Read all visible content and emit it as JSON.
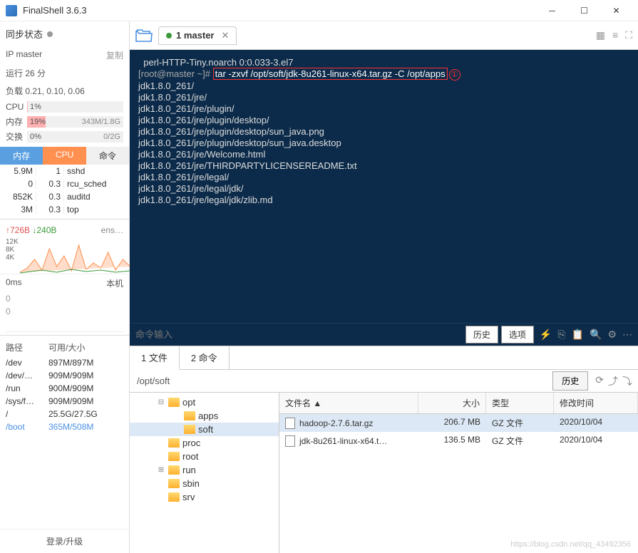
{
  "title": "FinalShell 3.6.3",
  "sidebar": {
    "sync_label": "同步状态",
    "ip_label": "IP master",
    "copy_label": "复制",
    "runtime": "运行 26 分",
    "load": "负载 0.21, 0.10, 0.06",
    "cpu_label": "CPU",
    "cpu_pct": "1%",
    "mem_label": "内存",
    "mem_pct": "19%",
    "mem_val": "343M/1.8G",
    "swap_label": "交换",
    "swap_pct": "0%",
    "swap_val": "0/2G",
    "tabs": {
      "mem": "内存",
      "cpu": "CPU",
      "cmd": "命令"
    },
    "procs": [
      {
        "mem": "5.9M",
        "cpu": "1",
        "name": "sshd"
      },
      {
        "mem": "0",
        "cpu": "0.3",
        "name": "rcu_sched"
      },
      {
        "mem": "852K",
        "cpu": "0.3",
        "name": "auditd"
      },
      {
        "mem": "3M",
        "cpu": "0.3",
        "name": "top"
      }
    ],
    "net_up": "726B",
    "net_down": "240B",
    "net_if": "ens…",
    "y12k": "12K",
    "y8k": "8K",
    "y4k": "4K",
    "ms": "0ms",
    "host_label": "本机",
    "z1": "0",
    "z2": "0",
    "disk_hdr": {
      "path": "路径",
      "usage": "可用/大小"
    },
    "disks": [
      {
        "path": "/dev",
        "usage": "897M/897M"
      },
      {
        "path": "/dev/…",
        "usage": "909M/909M"
      },
      {
        "path": "/run",
        "usage": "900M/909M"
      },
      {
        "path": "/sys/f…",
        "usage": "909M/909M"
      },
      {
        "path": "/",
        "usage": "25.5G/27.5G"
      },
      {
        "path": "/boot",
        "usage": "365M/508M"
      }
    ],
    "login": "登录/升级"
  },
  "tab": {
    "label": "1 master"
  },
  "terminal": {
    "line1": "  perl-HTTP-Tiny.noarch 0:0.033-3.el7",
    "prompt": "[root@master ~]# ",
    "cmd": "tar -zxvf /opt/soft/jdk-8u261-linux-x64.tar.gz -C /opt/apps",
    "marker": "①",
    "lines": [
      "jdk1.8.0_261/",
      "jdk1.8.0_261/jre/",
      "jdk1.8.0_261/jre/plugin/",
      "jdk1.8.0_261/jre/plugin/desktop/",
      "jdk1.8.0_261/jre/plugin/desktop/sun_java.png",
      "jdk1.8.0_261/jre/plugin/desktop/sun_java.desktop",
      "jdk1.8.0_261/jre/Welcome.html",
      "jdk1.8.0_261/jre/THIRDPARTYLICENSEREADME.txt",
      "jdk1.8.0_261/jre/legal/",
      "jdk1.8.0_261/jre/legal/jdk/",
      "jdk1.8.0_261/jre/legal/jdk/zlib.md"
    ],
    "placeholder": "命令输入",
    "history": "历史",
    "options": "选项"
  },
  "filepane": {
    "tab1": "1 文件",
    "tab2": "2 命令",
    "path": "/opt/soft",
    "history": "历史",
    "tree": {
      "opt": "opt",
      "apps": "apps",
      "soft": "soft",
      "proc": "proc",
      "root": "root",
      "run": "run",
      "sbin": "sbin",
      "srv": "srv"
    },
    "headers": {
      "name": "文件名 ▲",
      "size": "大小",
      "type": "类型",
      "date": "修改时间"
    },
    "files": [
      {
        "name": "hadoop-2.7.6.tar.gz",
        "size": "206.7 MB",
        "type": "GZ 文件",
        "date": "2020/10/04"
      },
      {
        "name": "jdk-8u261-linux-x64.t…",
        "size": "136.5 MB",
        "type": "GZ 文件",
        "date": "2020/10/04"
      }
    ]
  },
  "watermark": "https://blog.csdn.net/qq_43492356"
}
